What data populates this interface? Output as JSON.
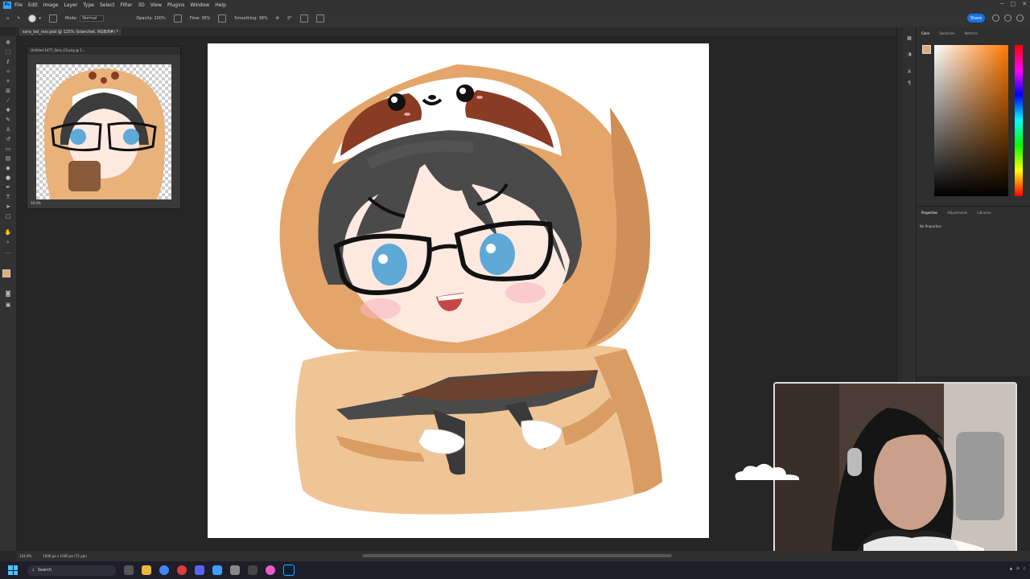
{
  "menubar": {
    "app_badge": "Ps",
    "items": [
      "File",
      "Edit",
      "Image",
      "Layer",
      "Type",
      "Select",
      "Filter",
      "3D",
      "View",
      "Plugins",
      "Window",
      "Help"
    ]
  },
  "options": {
    "mode_label": "Mode:",
    "mode_value": "Normal",
    "opacity_label": "Opacity: 100%",
    "flow_label": "Flow: 36%",
    "smoothing_label": "Smoothing: 38%",
    "angle_label": "0°",
    "share_label": "Share"
  },
  "document": {
    "tab_label": "sora_lsd_nov.psd @ 125% (blanchet, RGB/8#) *"
  },
  "navigator": {
    "title": "Untitled-1477_Sora_CS.png @ 1...",
    "zoom": "50.0%"
  },
  "color_panel": {
    "tabs": [
      "Color",
      "Swatches",
      "Patterns"
    ],
    "foreground": "#e8a870"
  },
  "properties_panel": {
    "tabs": [
      "Properties",
      "Adjustments",
      "Libraries"
    ],
    "message": "No Properties"
  },
  "status": {
    "zoom": "124.0%",
    "doc_info": "1000 px x 1000 px (72 ppi)"
  },
  "taskbar": {
    "search_placeholder": "Search"
  },
  "colors": {
    "hood": "#e4a56a",
    "hood_dark": "#cf8f58",
    "hood_inner": "#f0c596",
    "hair": "#4a4a4a",
    "skin": "#fde9df",
    "eye": "#5fa9d6",
    "accent_blue": "#1473e6"
  }
}
